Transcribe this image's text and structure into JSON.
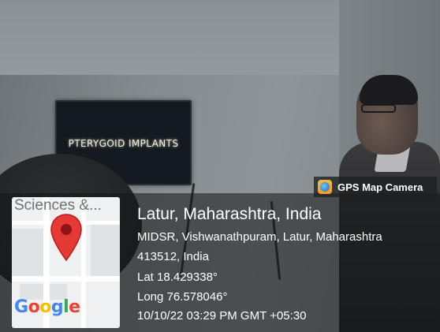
{
  "screen": {
    "tv_text": "PTERYGOID IMPLANTS"
  },
  "app_badge": {
    "icon": "gps-map-camera-icon",
    "label": "GPS Map Camera"
  },
  "map": {
    "place_label": "Sciences &...",
    "pin_icon": "map-pin-icon",
    "pin_color": "#e53935",
    "provider_logo": "Google"
  },
  "location": {
    "title": "Latur, Maharashtra, India",
    "address_line1": "MIDSR, Vishwanathpuram, Latur, Maharashtra",
    "address_line2": "413512, India",
    "latitude": "Lat 18.429338°",
    "longitude": "Long 76.578046°",
    "datetime": "10/10/22 03:29 PM GMT +05:30"
  }
}
